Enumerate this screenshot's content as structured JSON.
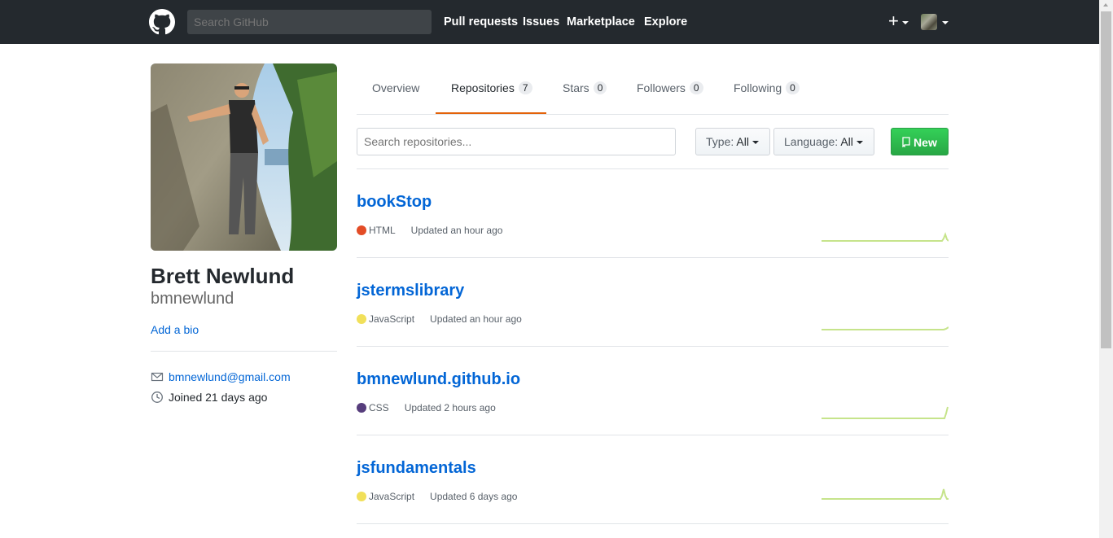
{
  "header": {
    "search_placeholder": "Search GitHub",
    "nav": [
      "Pull requests",
      "Issues",
      "Marketplace",
      "Explore"
    ],
    "plus_label": "+"
  },
  "profile": {
    "name": "Brett Newlund",
    "login": "bmnewlund",
    "add_bio": "Add a bio",
    "email": "bmnewlund@gmail.com",
    "joined": "Joined 21 days ago"
  },
  "tabs": [
    {
      "label": "Overview"
    },
    {
      "label": "Repositories",
      "count": "7"
    },
    {
      "label": "Stars",
      "count": "0"
    },
    {
      "label": "Followers",
      "count": "0"
    },
    {
      "label": "Following",
      "count": "0"
    }
  ],
  "filters": {
    "search_placeholder": "Search repositories...",
    "type_label": "Type:",
    "type_value": "All",
    "language_label": "Language:",
    "language_value": "All",
    "new_button": "New"
  },
  "repos": [
    {
      "name": "bookStop",
      "language": "HTML",
      "lang_color": "#e34c26",
      "updated": "Updated an hour ago"
    },
    {
      "name": "jstermslibrary",
      "language": "JavaScript",
      "lang_color": "#f1e05a",
      "updated": "Updated an hour ago"
    },
    {
      "name": "bmnewlund.github.io",
      "language": "CSS",
      "lang_color": "#563d7c",
      "updated": "Updated 2 hours ago"
    },
    {
      "name": "jsfundamentals",
      "language": "JavaScript",
      "lang_color": "#f1e05a",
      "updated": "Updated 6 days ago"
    }
  ],
  "colors": {
    "header_bg": "#24292e",
    "link": "#0366d6",
    "accent_tab": "#e36209",
    "new_button": "#28a745",
    "sparkline": "#c6e48b"
  }
}
